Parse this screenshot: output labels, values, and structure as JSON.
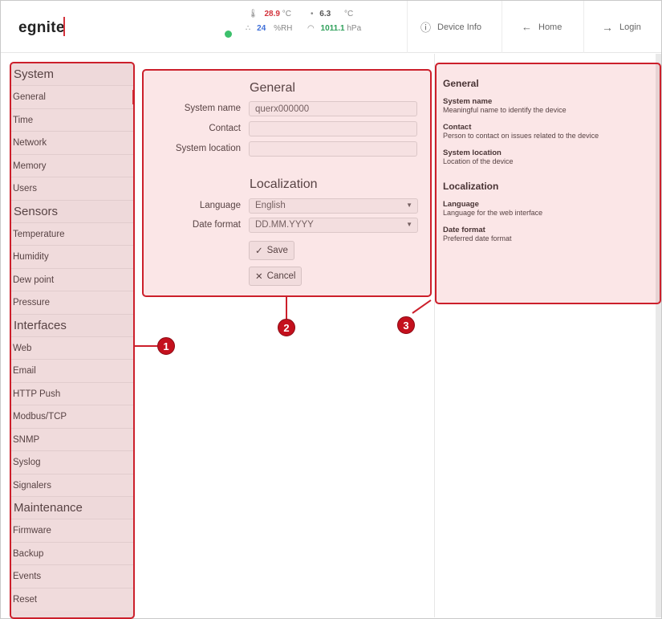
{
  "header": {
    "logo": "egnite",
    "sensors": {
      "temperature": {
        "value": "28.9",
        "unit": "°C",
        "icon": "thermometer-icon",
        "color": "#d3333c"
      },
      "humidity": {
        "value": "24",
        "unit": "%RH",
        "icon": "humidity-icon",
        "color": "#3f6fd8"
      },
      "dewpoint": {
        "value": "6.3",
        "unit": "°C",
        "icon": "drop-icon",
        "color": "#555555"
      },
      "pressure": {
        "value": "1011.1",
        "unit": "hPa",
        "icon": "gauge-icon",
        "color": "#2ea05a"
      }
    },
    "nav": {
      "device_info": "Device Info",
      "home": "Home",
      "login": "Login"
    }
  },
  "sidebar": {
    "system": {
      "heading": "System",
      "items": [
        "General",
        "Time",
        "Network",
        "Memory",
        "Users"
      ]
    },
    "sensors": {
      "heading": "Sensors",
      "items": [
        "Temperature",
        "Humidity",
        "Dew point",
        "Pressure"
      ]
    },
    "interfaces": {
      "heading": "Interfaces",
      "items": [
        "Web",
        "Email",
        "HTTP Push",
        "Modbus/TCP",
        "SNMP",
        "Syslog",
        "Signalers"
      ]
    },
    "maintenance": {
      "heading": "Maintenance",
      "items": [
        "Firmware",
        "Backup",
        "Events",
        "Reset"
      ]
    }
  },
  "form": {
    "general_title": "General",
    "system_name_label": "System name",
    "system_name_value": "querx000000",
    "contact_label": "Contact",
    "contact_value": "",
    "location_label": "System location",
    "location_value": "",
    "localization_title": "Localization",
    "language_label": "Language",
    "language_value": "English",
    "date_format_label": "Date format",
    "date_format_value": "DD.MM.YYYY",
    "save_label": "Save",
    "cancel_label": "Cancel"
  },
  "help": {
    "general_title": "General",
    "system_name_term": "System name",
    "system_name_desc": "Meaningful name to identify the device",
    "contact_term": "Contact",
    "contact_desc": "Person to contact on issues related to the device",
    "location_term": "System location",
    "location_desc": "Location of the device",
    "localization_title": "Localization",
    "language_term": "Language",
    "language_desc": "Language for the web interface",
    "date_format_term": "Date format",
    "date_format_desc": "Preferred date format"
  },
  "annotations": {
    "badge1": "1",
    "badge2": "2",
    "badge3": "3"
  },
  "colors": {
    "accent": "#d3333c",
    "status_ok": "#3cc06c",
    "annotation": "#cc1f2b"
  }
}
